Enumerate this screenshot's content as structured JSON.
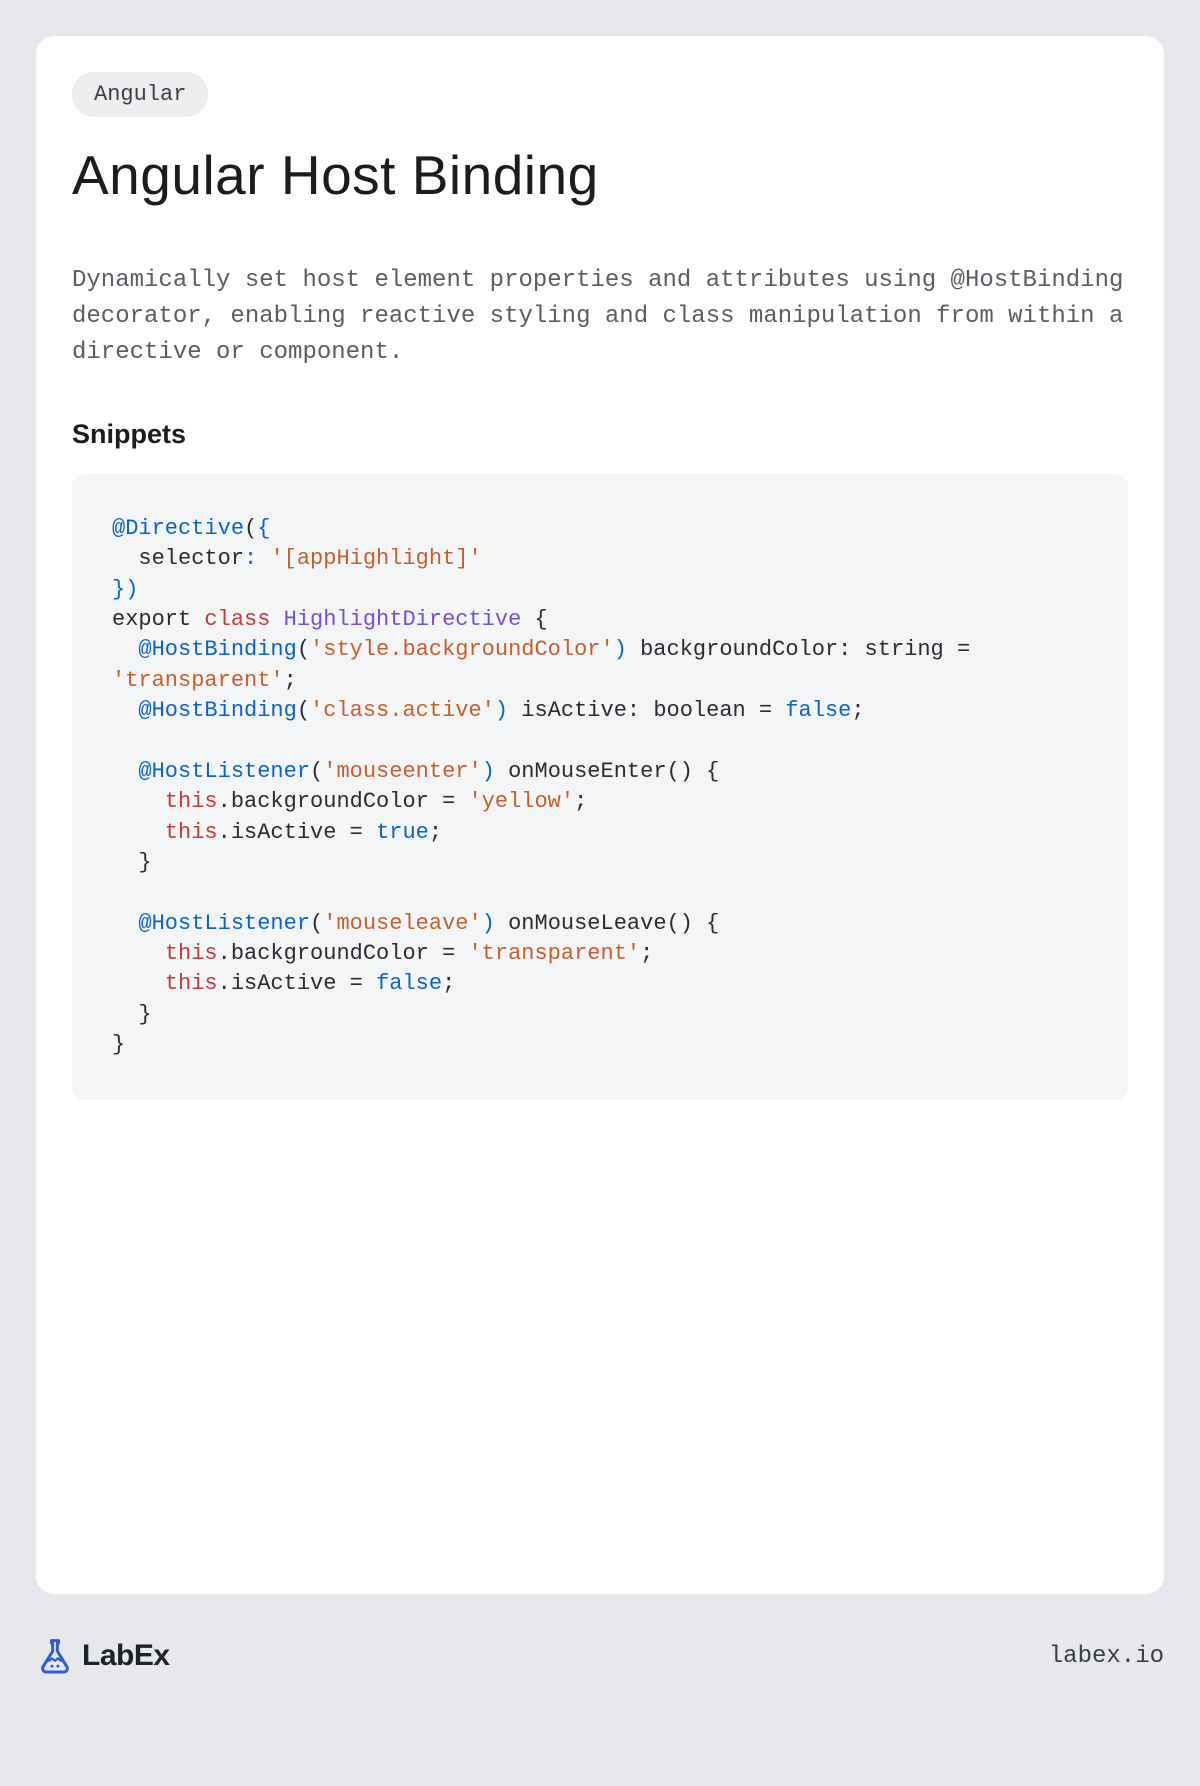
{
  "tag": "Angular",
  "title": "Angular Host Binding",
  "description": "Dynamically set host element properties and attributes using @HostBinding decorator, enabling reactive styling and class manipulation from within a directive or component.",
  "section_heading": "Snippets",
  "code": {
    "tokens": [
      {
        "t": "@Directive",
        "c": "blue"
      },
      {
        "t": "("
      },
      {
        "t": "{",
        "c": "blue"
      },
      {
        "t": "\n  selector"
      },
      {
        "t": ":",
        "c": "blue"
      },
      {
        "t": " "
      },
      {
        "t": "'[appHighlight]'",
        "c": "orange"
      },
      {
        "t": "\n"
      },
      {
        "t": "}",
        "c": "blue"
      },
      {
        "t": ")",
        "c": "blue"
      },
      {
        "t": "\nexport "
      },
      {
        "t": "class",
        "c": "red"
      },
      {
        "t": " "
      },
      {
        "t": "HighlightDirective",
        "c": "purple"
      },
      {
        "t": " {"
      },
      {
        "t": "\n  "
      },
      {
        "t": "@HostBinding",
        "c": "blue"
      },
      {
        "t": "("
      },
      {
        "t": "'style.backgroundColor'",
        "c": "orange"
      },
      {
        "t": ")",
        "c": "blue"
      },
      {
        "t": " backgroundColor: string = "
      },
      {
        "t": "'transparent'",
        "c": "orange"
      },
      {
        "t": ";"
      },
      {
        "t": "\n  "
      },
      {
        "t": "@HostBinding",
        "c": "blue"
      },
      {
        "t": "("
      },
      {
        "t": "'class.active'",
        "c": "orange"
      },
      {
        "t": ")",
        "c": "blue"
      },
      {
        "t": " isActive: boolean = "
      },
      {
        "t": "false",
        "c": "blue"
      },
      {
        "t": ";"
      },
      {
        "t": "\n\n  "
      },
      {
        "t": "@HostListener",
        "c": "blue"
      },
      {
        "t": "("
      },
      {
        "t": "'mouseenter'",
        "c": "orange"
      },
      {
        "t": ")",
        "c": "blue"
      },
      {
        "t": " onMouseEnter() {"
      },
      {
        "t": "\n    "
      },
      {
        "t": "this",
        "c": "red"
      },
      {
        "t": ".backgroundColor = "
      },
      {
        "t": "'yellow'",
        "c": "orange"
      },
      {
        "t": ";"
      },
      {
        "t": "\n    "
      },
      {
        "t": "this",
        "c": "red"
      },
      {
        "t": ".isActive = "
      },
      {
        "t": "true",
        "c": "blue"
      },
      {
        "t": ";"
      },
      {
        "t": "\n  }"
      },
      {
        "t": "\n\n  "
      },
      {
        "t": "@HostListener",
        "c": "blue"
      },
      {
        "t": "("
      },
      {
        "t": "'mouseleave'",
        "c": "orange"
      },
      {
        "t": ")",
        "c": "blue"
      },
      {
        "t": " onMouseLeave() {"
      },
      {
        "t": "\n    "
      },
      {
        "t": "this",
        "c": "red"
      },
      {
        "t": ".backgroundColor = "
      },
      {
        "t": "'transparent'",
        "c": "orange"
      },
      {
        "t": ";"
      },
      {
        "t": "\n    "
      },
      {
        "t": "this",
        "c": "red"
      },
      {
        "t": ".isActive = "
      },
      {
        "t": "false",
        "c": "blue"
      },
      {
        "t": ";"
      },
      {
        "t": "\n  }"
      },
      {
        "t": "\n}"
      }
    ]
  },
  "footer": {
    "brand": "LabEx",
    "domain": "labex.io"
  },
  "colors": {
    "blue": "#0b63c9",
    "orange": "#c75f2c",
    "purple": "#7b4dd6",
    "red": "#c73a3a",
    "page_bg": "#e6e8eb",
    "card_bg": "#ffffff",
    "tag_bg": "#edeef0",
    "code_bg": "#f4f5f6"
  }
}
